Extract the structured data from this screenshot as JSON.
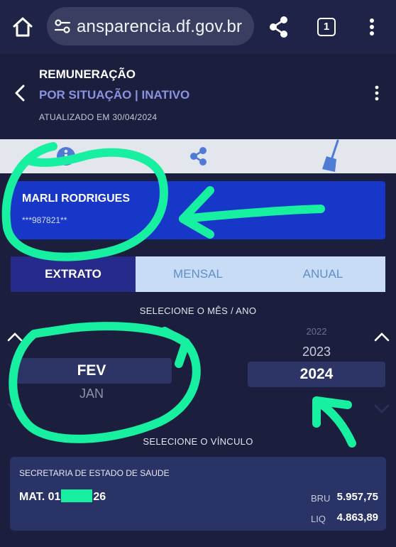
{
  "browser": {
    "url": "ansparencia.df.gov.br",
    "tab_count": "1",
    "icons": [
      "home-icon",
      "site-settings-icon",
      "share-icon",
      "tab-switcher-icon",
      "more-vert-icon"
    ]
  },
  "header": {
    "title": "REMUNERAÇÃO",
    "subtitle": "POR SITUAÇÃO | INATIVO",
    "updated": "ATUALIZADO EM 30/04/2024"
  },
  "toolbar": {
    "icons": [
      "info-icon",
      "share-icon",
      "broom-icon"
    ]
  },
  "person": {
    "name": "MARLI RODRIGUES",
    "id_masked": "***987821**"
  },
  "tabs": [
    {
      "label": "EXTRATO",
      "active": true
    },
    {
      "label": "MENSAL",
      "active": false
    },
    {
      "label": "ANUAL",
      "active": false
    }
  ],
  "month_year": {
    "label": "SELECIONE O MÊS / ANO",
    "month_selected": "FEV",
    "month_next": "JAN",
    "years": [
      "2022",
      "2023"
    ],
    "year_selected": "2024"
  },
  "vinculo": {
    "label": "SELECIONE O VÍNCULO",
    "org": "SECRETARIA DE ESTADO DE SAUDE",
    "mat_prefix": "MAT. 01",
    "mat_suffix": "26",
    "bru_label": "BRU",
    "bru_value": "5.957,75",
    "liq_label": "LIQ",
    "liq_value": "4.863,89"
  },
  "colors": {
    "background": "#1b1f3d",
    "card_blue": "#1737c8",
    "tab_active": "#262a8a",
    "tab_inactive": "#c9dcf6",
    "subtitle": "#8c91e0",
    "annotation": "#16f0a0"
  }
}
